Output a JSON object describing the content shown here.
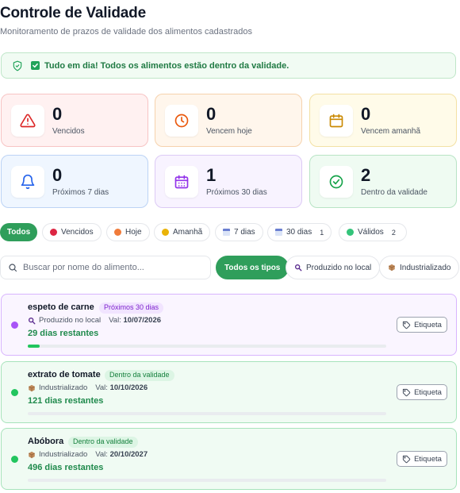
{
  "header": {
    "title": "Controle de Validade",
    "subtitle": "Monitoramento de prazos de validade dos alimentos cadastrados"
  },
  "alert": {
    "message": "Tudo em dia! Todos os alimentos estão dentro da validade.",
    "icon": "shield-icon",
    "color": "#1f7a43"
  },
  "stats": [
    {
      "value": "0",
      "label": "Vencidos",
      "icon": "warning-triangle-icon",
      "bg": "#fff1f1",
      "border": "#f7c4c4",
      "icon_color": "#dc2626"
    },
    {
      "value": "0",
      "label": "Vencem hoje",
      "icon": "clock-icon",
      "bg": "#fff6ec",
      "border": "#f6d2ad",
      "icon_color": "#ea580c"
    },
    {
      "value": "0",
      "label": "Vencem amanhã",
      "icon": "calendar-icon",
      "bg": "#fffbe9",
      "border": "#f3e1a4",
      "icon_color": "#ca8a04"
    },
    {
      "value": "0",
      "label": "Próximos 7 dias",
      "icon": "bell-icon",
      "bg": "#eff6ff",
      "border": "#bcd3f5",
      "icon_color": "#2563eb"
    },
    {
      "value": "1",
      "label": "Próximos 30 dias",
      "icon": "calendar-grid-icon",
      "bg": "#f8f3ff",
      "border": "#dccaf5",
      "icon_color": "#9333ea"
    },
    {
      "value": "2",
      "label": "Dentro da validade",
      "icon": "check-circle-icon",
      "bg": "#effbf2",
      "border": "#b8e4c5",
      "icon_color": "#16a34a"
    }
  ],
  "filters": [
    {
      "label": "Todos",
      "active": true
    },
    {
      "label": "Vencidos",
      "dot": "#dc2643"
    },
    {
      "label": "Hoje",
      "dot": "#f07b3a"
    },
    {
      "label": "Amanhã",
      "dot": "#eab308"
    },
    {
      "label": "7 dias",
      "cal": true
    },
    {
      "label": "30 dias",
      "cal": true,
      "count": "1"
    },
    {
      "label": "Válidos",
      "dot": "#34c47a",
      "count": "2"
    }
  ],
  "search": {
    "placeholder": "Buscar por nome do alimento..."
  },
  "type_filters": [
    {
      "label": "Todos os tipos",
      "active": true
    },
    {
      "label": "Produzido no local",
      "icon": "magnifier-icon"
    },
    {
      "label": "Industrializado",
      "icon": "box-icon"
    }
  ],
  "items": [
    {
      "name": "espeto de carne",
      "badge": "Próximos 30 dias",
      "type": "Produzido no local",
      "type_icon": "magnifier-icon",
      "val_label": "Val:",
      "val_date": "10/07/2026",
      "remaining": "29 dias restantes",
      "progress": 0.03,
      "tag_label": "Etiqueta",
      "status_color": "#a855f7",
      "bg": "#faf5ff",
      "border": "#d8b4fe",
      "badge_bg": "#f1e4ff",
      "badge_color": "#7e22ce"
    },
    {
      "name": "extrato de tomate",
      "badge": "Dentro da validade",
      "type": "Industrializado",
      "type_icon": "box-icon",
      "val_label": "Val:",
      "val_date": "10/10/2026",
      "remaining": "121 dias restantes",
      "progress": 0,
      "tag_label": "Etiqueta",
      "status_color": "#22c55e",
      "bg": "#f0fbf3",
      "border": "#a7e3bb",
      "badge_bg": "#dcf5e4",
      "badge_color": "#15803d"
    },
    {
      "name": "Abóbora",
      "badge": "Dentro da validade",
      "type": "Industrializado",
      "type_icon": "box-icon",
      "val_label": "Val:",
      "val_date": "20/10/2027",
      "remaining": "496 dias restantes",
      "progress": 0,
      "tag_label": "Etiqueta",
      "status_color": "#22c55e",
      "bg": "#f0fbf3",
      "border": "#a7e3bb",
      "badge_bg": "#dcf5e4",
      "badge_color": "#15803d"
    }
  ]
}
